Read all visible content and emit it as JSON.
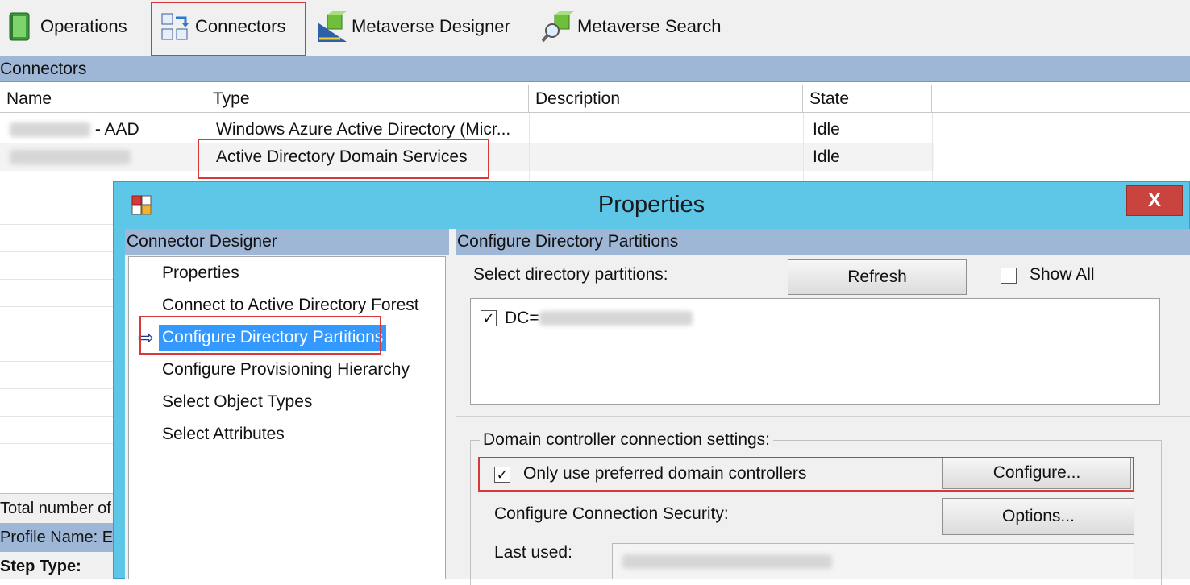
{
  "toolbar": {
    "items": [
      {
        "label": "Operations",
        "icon": "operations-icon"
      },
      {
        "label": "Connectors",
        "icon": "connectors-icon"
      },
      {
        "label": "Metaverse Designer",
        "icon": "metaverse-designer-icon"
      },
      {
        "label": "Metaverse Search",
        "icon": "metaverse-search-icon"
      }
    ]
  },
  "connectors": {
    "section_title": "Connectors",
    "columns": [
      "Name",
      "Type",
      "Description",
      "State"
    ],
    "rows": [
      {
        "name_suffix": "- AAD",
        "type": "Windows Azure Active Directory (Micr...",
        "description": "",
        "state": "Idle"
      },
      {
        "name_suffix": "",
        "type": "Active Directory Domain Services",
        "description": "",
        "state": "Idle"
      }
    ]
  },
  "status": {
    "total": "Total number of",
    "profile": "Profile Name: E",
    "step_type": "Step Type:"
  },
  "dialog": {
    "title": "Properties",
    "close_label": "X",
    "left_pane": {
      "header": "Connector Designer",
      "items": [
        "Properties",
        "Connect to Active Directory Forest",
        "Configure Directory Partitions",
        "Configure Provisioning Hierarchy",
        "Select Object Types",
        "Select Attributes"
      ],
      "selected_index": 2
    },
    "right_pane": {
      "header": "Configure Directory Partitions",
      "select_label": "Select directory partitions:",
      "refresh_label": "Refresh",
      "show_all_label": "Show All",
      "show_all_checked": false,
      "partition_prefix": "DC=",
      "partition_checked": true,
      "group_title": "Domain controller connection settings:",
      "preferred_dc_label": "Only use preferred domain controllers",
      "preferred_dc_checked": true,
      "configure_label": "Configure...",
      "security_label": "Configure Connection Security:",
      "options_label": "Options...",
      "last_used_label": "Last used:"
    }
  },
  "colors": {
    "dialog_title_bg": "#5ec7e8",
    "pane_header_bg": "#9fb7d6",
    "highlight_box": "#d9383b",
    "selection_bg": "#3399ff",
    "close_button_bg": "#c9443e"
  }
}
